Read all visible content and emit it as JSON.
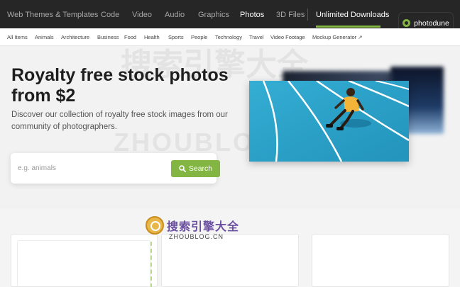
{
  "topnav": {
    "items": [
      {
        "label": "Web Themes & Templates"
      },
      {
        "label": "Code"
      },
      {
        "label": "Video"
      },
      {
        "label": "Audio"
      },
      {
        "label": "Graphics"
      },
      {
        "label": "Photos"
      },
      {
        "label": "3D Files"
      },
      {
        "label": "Unlimited Downloads"
      }
    ],
    "active": "Photos",
    "brand": "photodune"
  },
  "subnav": {
    "items": [
      {
        "label": "All Items"
      },
      {
        "label": "Animals"
      },
      {
        "label": "Architecture"
      },
      {
        "label": "Business"
      },
      {
        "label": "Food"
      },
      {
        "label": "Health"
      },
      {
        "label": "Sports"
      },
      {
        "label": "People"
      },
      {
        "label": "Technology"
      },
      {
        "label": "Travel"
      },
      {
        "label": "Video Footage"
      },
      {
        "label": "Mockup Generator ↗"
      }
    ]
  },
  "hero": {
    "headline": "Royalty free stock photos from $2",
    "subtext": "Discover our collection of royalty free stock images from our community of photographers.",
    "search": {
      "placeholder": "e.g. animals",
      "button_label": "Search"
    }
  },
  "watermark": {
    "cn": "搜索引擎大全",
    "en": "ZHOUBLOG.CN",
    "big_en": "ZHOUBLOGS.CN"
  },
  "colors": {
    "accent": "#82b541",
    "nav_bg": "#262626"
  }
}
